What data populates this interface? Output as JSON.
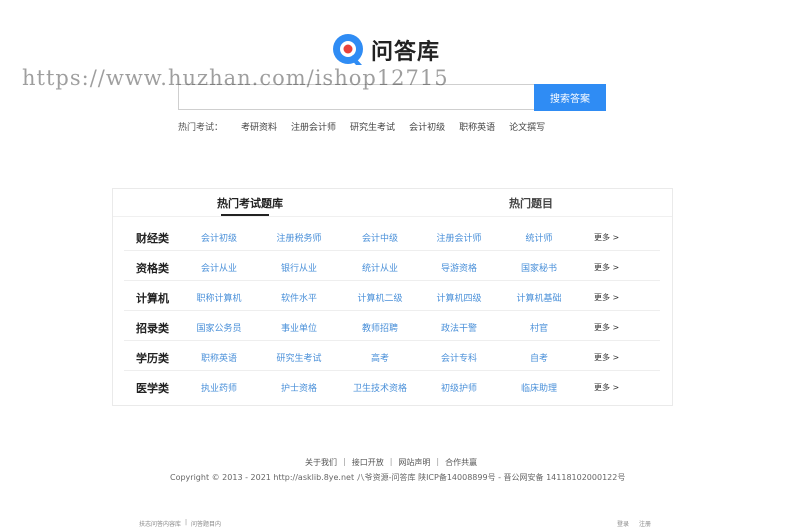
{
  "brand": {
    "name": "问答库",
    "accent": "#2f8cf4"
  },
  "watermark": "https://www.huzhan.com/ishop12715",
  "search": {
    "placeholder": "",
    "button_label": "搜索答案"
  },
  "hot_exams": {
    "label": "热门考试：",
    "items": [
      "考研资料",
      "注册会计师",
      "研究生考试",
      "会计初级",
      "职称英语",
      "论文撰写"
    ]
  },
  "tabs": [
    {
      "label": "热门考试题库",
      "active": true
    },
    {
      "label": "热门题目",
      "active": false
    }
  ],
  "categories": [
    {
      "title": "财经类",
      "links": [
        "会计初级",
        "注册税务师",
        "会计中级",
        "注册会计师",
        "统计师"
      ],
      "more": "更多 >"
    },
    {
      "title": "资格类",
      "links": [
        "会计从业",
        "银行从业",
        "统计从业",
        "导游资格",
        "国家秘书"
      ],
      "more": "更多 >"
    },
    {
      "title": "计算机",
      "links": [
        "职称计算机",
        "软件水平",
        "计算机二级",
        "计算机四级",
        "计算机基础"
      ],
      "more": "更多 >"
    },
    {
      "title": "招录类",
      "links": [
        "国家公务员",
        "事业单位",
        "教师招聘",
        "政法干警",
        "村官"
      ],
      "more": "更多 >"
    },
    {
      "title": "学历类",
      "links": [
        "职称英语",
        "研究生考试",
        "高考",
        "会计专科",
        "自考"
      ],
      "more": "更多 >"
    },
    {
      "title": "医学类",
      "links": [
        "执业药师",
        "护士资格",
        "卫生技术资格",
        "初级护师",
        "临床助理"
      ],
      "more": "更多 >"
    }
  ],
  "footer": {
    "links": [
      "关于我们",
      "接口开放",
      "网站声明",
      "合作共赢"
    ],
    "copyright": "Copyright © 2013 - 2021 http://asklib.8ye.net  八爷资源-问答库   陕ICP备14008899号 - 晋公网安备 14118102000122号"
  },
  "bottom_bar": {
    "left": [
      "扶志问答内容库",
      "问答题目内"
    ],
    "right": [
      "登录",
      "注册"
    ]
  }
}
